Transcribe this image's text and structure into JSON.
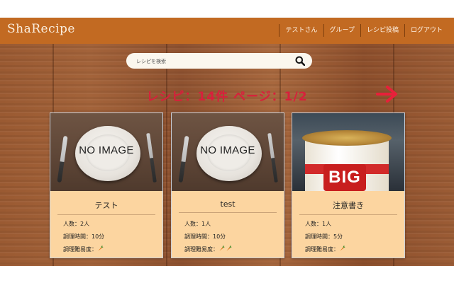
{
  "app": {
    "title": "ShaRecipe",
    "colors": {
      "header": "#c26a22",
      "accent": "#d8203c",
      "card": "#fcd5a0"
    }
  },
  "nav": {
    "items": [
      "テストさん",
      "グループ",
      "レシピ投稿",
      "ログアウト"
    ]
  },
  "search": {
    "placeholder": "レシピを検索",
    "icon": "search-icon"
  },
  "summary": {
    "text": "レシピ：14件 ページ：1/2"
  },
  "pager": {
    "next_icon": "arrow-right-icon"
  },
  "recipes": [
    {
      "image": "NO IMAGE",
      "title": "テスト",
      "servings": "人数：2人",
      "time": "調理時間：10分",
      "difficulty_label": "調理難易度：",
      "difficulty": 1
    },
    {
      "image": "NO IMAGE",
      "title": "test",
      "servings": "人数：1人",
      "time": "調理時間：10分",
      "difficulty_label": "調理難易度：",
      "difficulty": 2
    },
    {
      "image": "BIG",
      "title": "注意書き",
      "servings": "人数：1人",
      "time": "調理時間：5分",
      "difficulty_label": "調理難易度：",
      "difficulty": 1
    }
  ]
}
